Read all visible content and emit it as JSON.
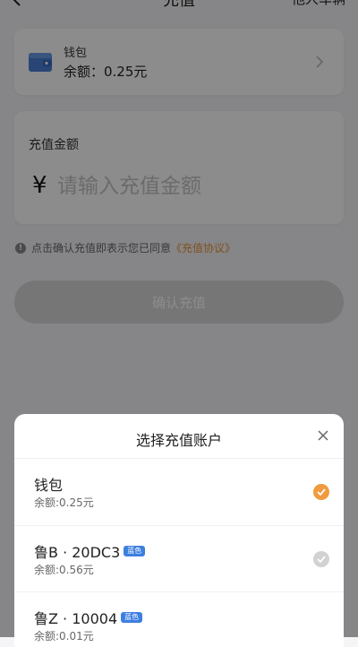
{
  "nav": {
    "title": "充值",
    "right": "他人车辆"
  },
  "wallet": {
    "name": "钱包",
    "balance": "余额：0.25元"
  },
  "amount": {
    "label": "充值金额",
    "currency": "¥",
    "placeholder": "请输入充值金额",
    "value": ""
  },
  "notice": {
    "text": "点击确认充值即表示您已同意",
    "agreement": "《充值协议》"
  },
  "confirm_button": "确认充值",
  "sheet": {
    "title": "选择充值账户",
    "accounts": [
      {
        "name": "钱包",
        "tag": "",
        "balance": "余额:0.25元",
        "selected": true
      },
      {
        "name": "鲁B · 20DC3",
        "tag": "蓝色",
        "balance": "余额:0.56元",
        "selected": false
      },
      {
        "name": "鲁Z · 10004",
        "tag": "蓝色",
        "balance": "余额:0.01元",
        "selected": false
      }
    ]
  },
  "colors": {
    "accent": "#f19a3e",
    "tag_blue": "#3d7fe0",
    "wallet_icon": "#4a7fd6"
  },
  "icons": {
    "back": "back-arrow-icon",
    "wallet": "wallet-icon",
    "chevron": "chevron-right-icon",
    "info": "info-icon",
    "close": "close-icon",
    "check": "check-icon"
  }
}
